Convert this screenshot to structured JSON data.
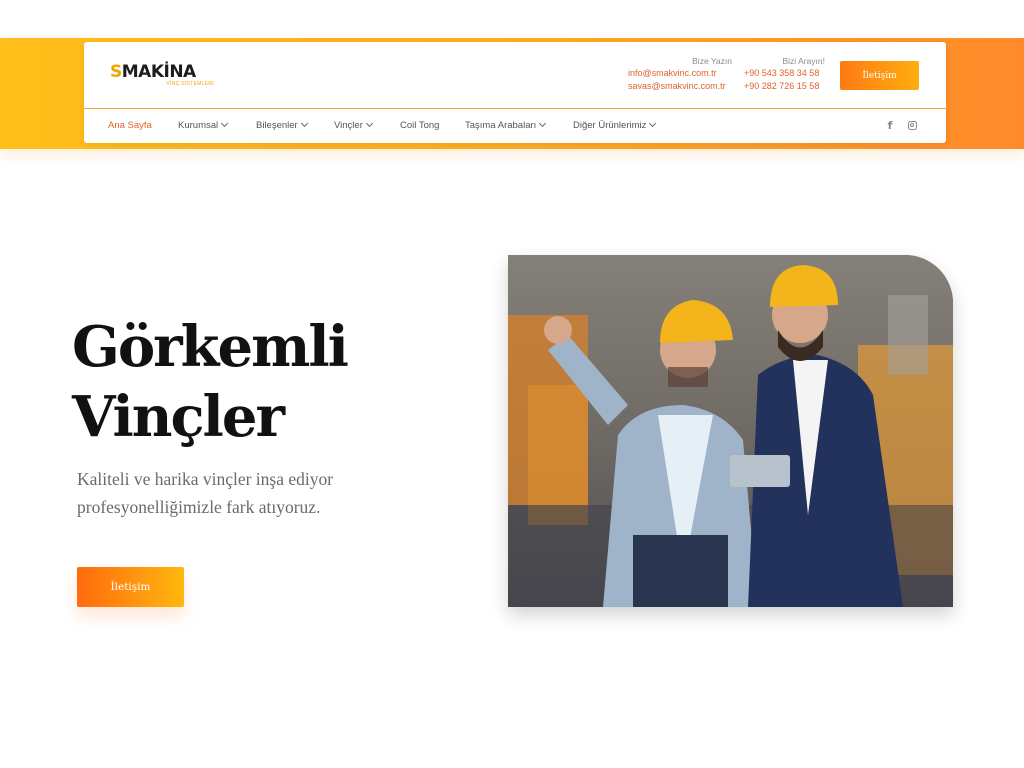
{
  "header": {
    "logo": {
      "text_s": "S",
      "text_rest": "MAKİNA",
      "subtitle": "VİNÇ SİSTEMLERİ"
    },
    "contact_mail": {
      "title": "Bize Yazın",
      "lines": [
        "info@smakvinc.com.tr",
        "savas@smakvinc.com.tr"
      ]
    },
    "contact_phone": {
      "title": "Bizi Arayın!",
      "lines": [
        "+90 543 358 34 58",
        "+90 282 726 15 58"
      ]
    },
    "contact_button": "İletişim"
  },
  "nav": {
    "items": [
      {
        "label": "Ana Sayfa",
        "active": true,
        "dropdown": false
      },
      {
        "label": "Kurumsal",
        "active": false,
        "dropdown": true
      },
      {
        "label": "Bileşenler",
        "active": false,
        "dropdown": true
      },
      {
        "label": "Vinçler",
        "active": false,
        "dropdown": true
      },
      {
        "label": "Coil Tong",
        "active": false,
        "dropdown": false
      },
      {
        "label": "Taşıma Arabaları",
        "active": false,
        "dropdown": true
      },
      {
        "label": "Diğer Ürünlerimiz",
        "active": false,
        "dropdown": true
      }
    ],
    "social": [
      "facebook-icon",
      "instagram-icon"
    ]
  },
  "hero": {
    "title_line1": "Görkemli",
    "title_line2": "Vinçler",
    "description": "Kaliteli ve harika vinçler inşa ediyor profesyonelliğimizle fark atıyoruz.",
    "button": "İletişim"
  },
  "colors": {
    "accent_orange": "#ff8a2b",
    "accent_yellow": "#ffbf1a",
    "link_orange": "#e0632a"
  }
}
